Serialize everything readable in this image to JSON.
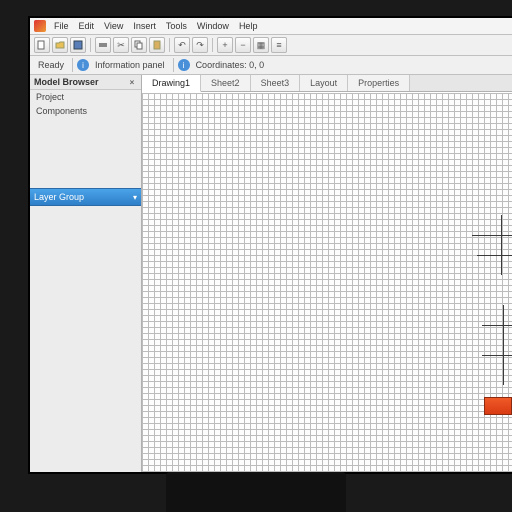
{
  "menubar": {
    "items": [
      "File",
      "Edit",
      "View",
      "Insert",
      "Tools",
      "Window",
      "Help"
    ]
  },
  "toolbar1": {
    "icons": [
      "new",
      "open",
      "save",
      "print",
      "cut",
      "copy",
      "paste",
      "undo",
      "redo",
      "zoom-in",
      "zoom-out",
      "grid",
      "layers"
    ]
  },
  "toolbar2": {
    "status1": "Ready",
    "info1": "Information panel",
    "info2": "Coordinates: 0, 0"
  },
  "sidebar": {
    "header": "Model Browser",
    "item1": "Project",
    "item2": "Components",
    "dropdown": "Layer Group"
  },
  "tabs": {
    "items": [
      "Drawing1",
      "Sheet2",
      "Sheet3",
      "Layout",
      "Properties"
    ],
    "activeIndex": 0
  }
}
